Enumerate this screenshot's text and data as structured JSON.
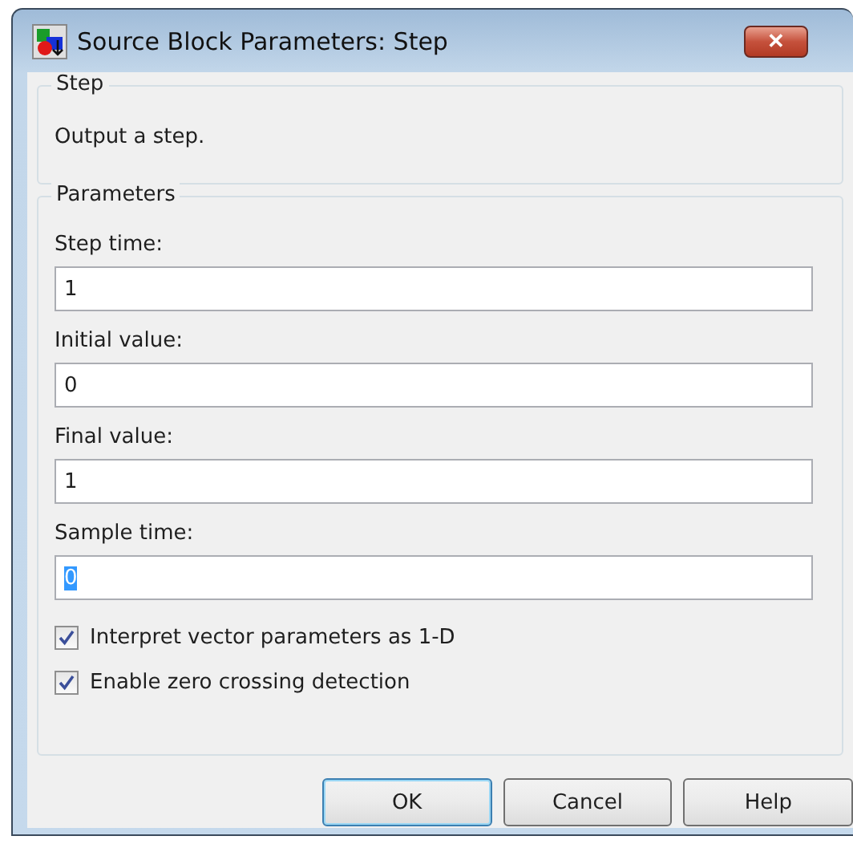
{
  "window": {
    "title": "Source Block Parameters: Step",
    "close": "✕"
  },
  "description_group": {
    "title": "Step",
    "text": "Output a step."
  },
  "parameters_group": {
    "title": "Parameters",
    "fields": [
      {
        "label": "Step time:",
        "value": "1",
        "text_selected": false
      },
      {
        "label": "Initial value:",
        "value": "0",
        "text_selected": false
      },
      {
        "label": "Final value:",
        "value": "1",
        "text_selected": false
      },
      {
        "label": "Sample time:",
        "value": "0",
        "text_selected": true
      }
    ],
    "checkboxes": [
      {
        "label": "Interpret vector parameters as 1-D",
        "checked": true
      },
      {
        "label": "Enable zero crossing detection",
        "checked": true
      }
    ]
  },
  "buttons": [
    {
      "label": "OK",
      "default": true
    },
    {
      "label": "Cancel",
      "default": false
    },
    {
      "label": "Help",
      "default": false
    }
  ]
}
